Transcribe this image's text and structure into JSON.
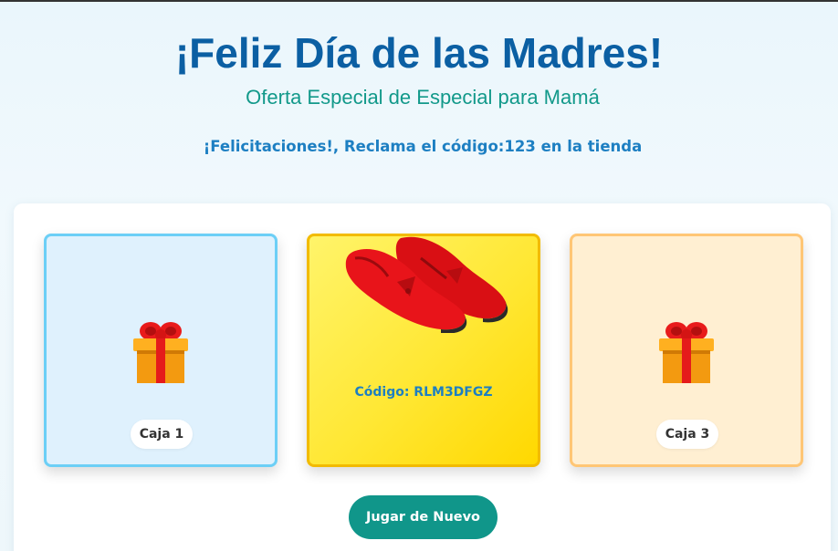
{
  "header": {
    "title": "¡Feliz Día de las Madres!",
    "subtitle": "Oferta Especial de Especial para Mamá",
    "message": "¡Felicitaciones!, Reclama el código:123 en la tienda"
  },
  "boxes": [
    {
      "label": "Caja 1",
      "icon": "gift-icon",
      "state": "closed"
    },
    {
      "label": "Código: RLM3DFGZ",
      "icon": "red-shoes-icon",
      "state": "opened"
    },
    {
      "label": "Caja 3",
      "icon": "gift-icon",
      "state": "closed"
    }
  ],
  "actions": {
    "play_again": "Jugar de Nuevo"
  },
  "colors": {
    "title": "#0b5fa3",
    "subtitle": "#12998a",
    "accent": "#1d7fc2",
    "button": "#10968a",
    "box1_border": "#6ccff6",
    "box2_border": "#f2bb00",
    "box3_border": "#ffc675"
  }
}
